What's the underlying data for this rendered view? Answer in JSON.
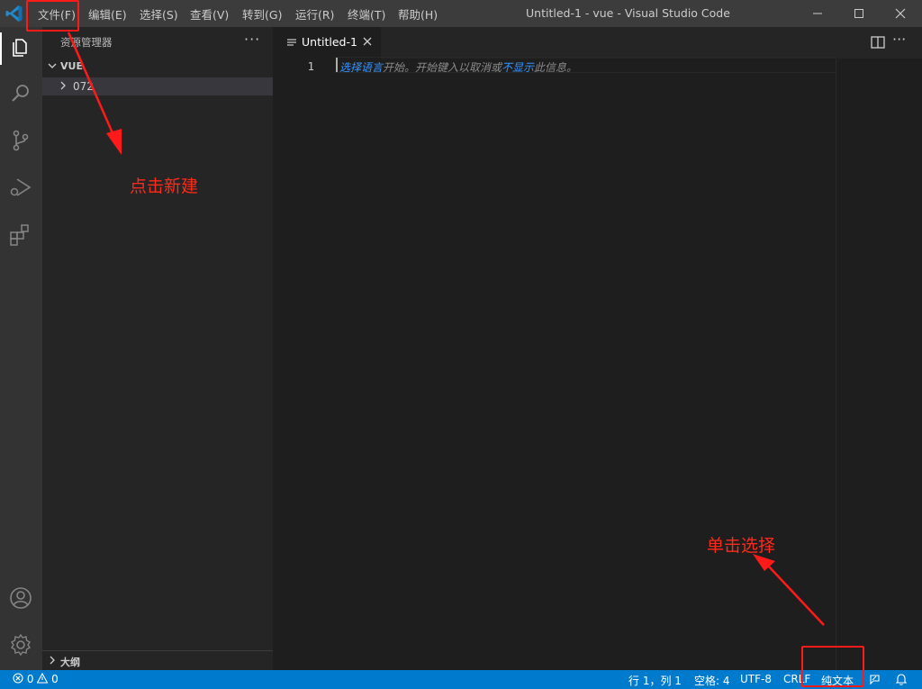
{
  "titlebar": {
    "menu": [
      "文件(F)",
      "编辑(E)",
      "选择(S)",
      "查看(V)",
      "转到(G)",
      "运行(R)",
      "终端(T)",
      "帮助(H)"
    ],
    "window_title": "Untitled-1 - vue - Visual Studio Code"
  },
  "sidebar": {
    "title": "资源管理器",
    "more": "···",
    "workspace": "VUE",
    "folder": "072",
    "outline": "大纲"
  },
  "editor": {
    "tab_label": "Untitled-1",
    "line_number": "1",
    "hint_link1": "选择语言",
    "hint_mid": "开始。开始键入以取消或",
    "hint_link2": "不显示",
    "hint_end": "此信息。"
  },
  "statusbar": {
    "errors": "0",
    "warnings": "0",
    "position": "行 1，列 1",
    "spaces": "空格: 4",
    "encoding": "UTF-8",
    "eol": "CRLF",
    "language": "纯文本"
  },
  "annotations": {
    "new_file": "点击新建",
    "click_select": "单击选择"
  },
  "colors": {
    "accent": "#007acc",
    "annotation": "#ff1a1a"
  }
}
